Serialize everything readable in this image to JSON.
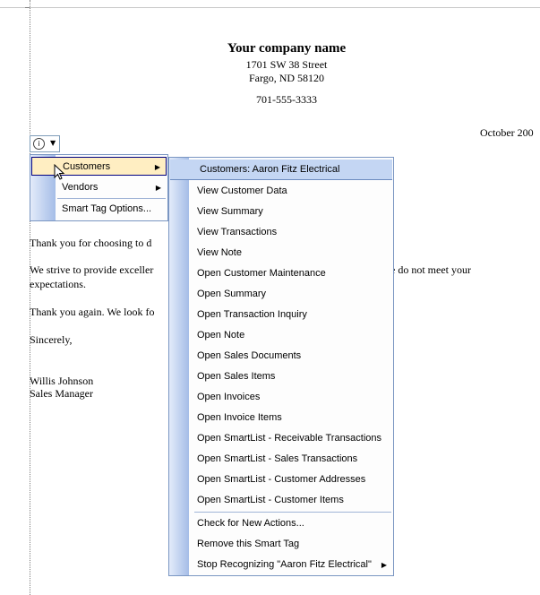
{
  "document": {
    "company_name": "Your company name",
    "address_line1": "1701 SW 38 Street",
    "address_line2": "Fargo, ND 58120",
    "phone": "701-555-3333",
    "date": "October 200",
    "paragraph1": "Thank you for choosing to d",
    "paragraph2_left": "We strive to provide exceller",
    "paragraph2_right": "e do not meet your",
    "paragraph2_line2": "expectations.",
    "paragraph3": "Thank you again. We look fo",
    "closing": "Sincerely,",
    "signature_name": "Willis Johnson",
    "signature_title": "Sales Manager"
  },
  "smart_tag": {
    "icon": "info-icon",
    "dropdown_icon": "dropdown-arrow-icon"
  },
  "smart_tag_menu": {
    "items": [
      {
        "label": "Customers",
        "has_submenu": true
      },
      {
        "label": "Vendors",
        "has_submenu": true
      },
      {
        "label": "Smart Tag Options..."
      }
    ]
  },
  "customers_submenu": {
    "header": "Customers: Aaron Fitz Electrical",
    "items": [
      "View Customer Data",
      "View Summary",
      "View Transactions",
      "View Note",
      "Open Customer Maintenance",
      "Open Summary",
      "Open Transaction Inquiry",
      "Open Note",
      "Open Sales Documents",
      "Open Sales Items",
      "Open Invoices",
      "Open Invoice Items",
      "Open SmartList - Receivable Transactions",
      "Open SmartList - Sales Transactions",
      "Open SmartList - Customer Addresses",
      "Open SmartList - Customer Items"
    ],
    "footer_items": [
      "Check for New Actions...",
      "Remove this Smart Tag",
      "Stop Recognizing \"Aaron Fitz Electrical\""
    ]
  }
}
